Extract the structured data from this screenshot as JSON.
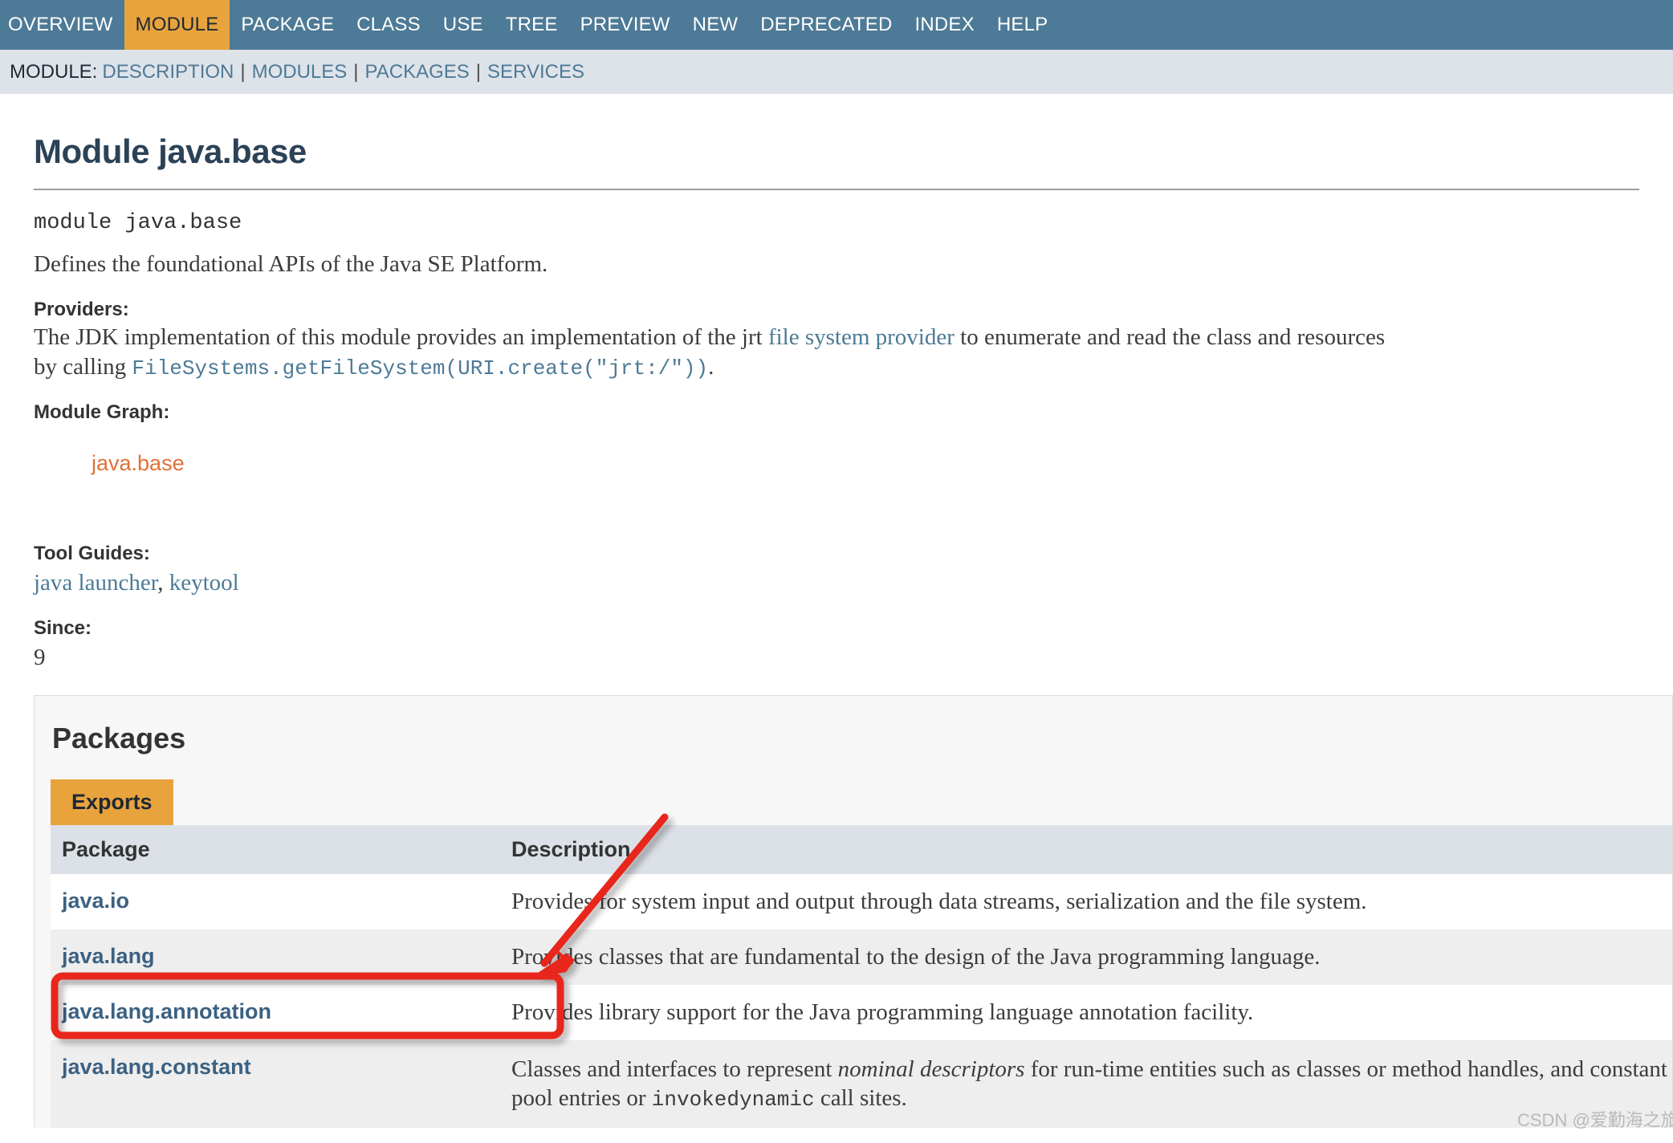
{
  "topnav": {
    "items": [
      {
        "label": "OVERVIEW",
        "active": false
      },
      {
        "label": "MODULE",
        "active": true
      },
      {
        "label": "PACKAGE",
        "active": false
      },
      {
        "label": "CLASS",
        "active": false
      },
      {
        "label": "USE",
        "active": false
      },
      {
        "label": "TREE",
        "active": false
      },
      {
        "label": "PREVIEW",
        "active": false
      },
      {
        "label": "NEW",
        "active": false
      },
      {
        "label": "DEPRECATED",
        "active": false
      },
      {
        "label": "INDEX",
        "active": false
      },
      {
        "label": "HELP",
        "active": false
      }
    ]
  },
  "subnav": {
    "label": "MODULE:",
    "links": [
      "DESCRIPTION",
      "MODULES",
      "PACKAGES",
      "SERVICES"
    ],
    "separator": "|"
  },
  "page": {
    "title": "Module java.base",
    "declaration": "module java.base",
    "summary": "Defines the foundational APIs of the Java SE Platform."
  },
  "providers": {
    "heading": "Providers:",
    "text_before_link": "The JDK implementation of this module provides an implementation of the jrt ",
    "link": "file system provider",
    "text_after_link": " to enumerate and read the class and resources",
    "line2_prefix": "by calling ",
    "line2_code": "FileSystems.getFileSystem(URI.create(\"jrt:/\"))",
    "line2_suffix": "."
  },
  "module_graph": {
    "heading": "Module Graph:",
    "node": "java.base"
  },
  "tool_guides": {
    "heading": "Tool Guides:",
    "links": [
      "java launcher",
      "keytool"
    ],
    "separator": ", "
  },
  "since": {
    "heading": "Since:",
    "value": "9"
  },
  "packages": {
    "title": "Packages",
    "tab": "Exports",
    "columns": [
      "Package",
      "Description"
    ],
    "rows": [
      {
        "package": "java.io",
        "description": "Provides for system input and output through data streams, serialization and the file system."
      },
      {
        "package": "java.lang",
        "description": "Provides classes that are fundamental to the design of the Java programming language."
      },
      {
        "package": "java.lang.annotation",
        "description": "Provides library support for the Java programming language annotation facility."
      },
      {
        "package": "java.lang.constant",
        "desc_part1": "Classes and interfaces to represent ",
        "desc_italic": "nominal descriptors",
        "desc_part2": " for run-time entities such as classes or method handles, and",
        "desc_line2_part1": "constant pool entries or ",
        "desc_line2_mono": "invokedynamic",
        "desc_line2_part2": " call sites."
      }
    ]
  },
  "annotation": {
    "highlight_target": "java.lang",
    "color": "#e8261c"
  },
  "watermark": {
    "text": "CSDN @爱勤海之旅"
  },
  "colors": {
    "navbar_bg": "#4d7a96",
    "navbar_active_bg": "#e8a33d",
    "subnav_bg": "#dee3e9",
    "link": "#4d7a96",
    "heading": "#2b4257",
    "graph_node": "#e2703a",
    "table_header_bg": "#dce1e7",
    "annotation_red": "#e8261c"
  }
}
